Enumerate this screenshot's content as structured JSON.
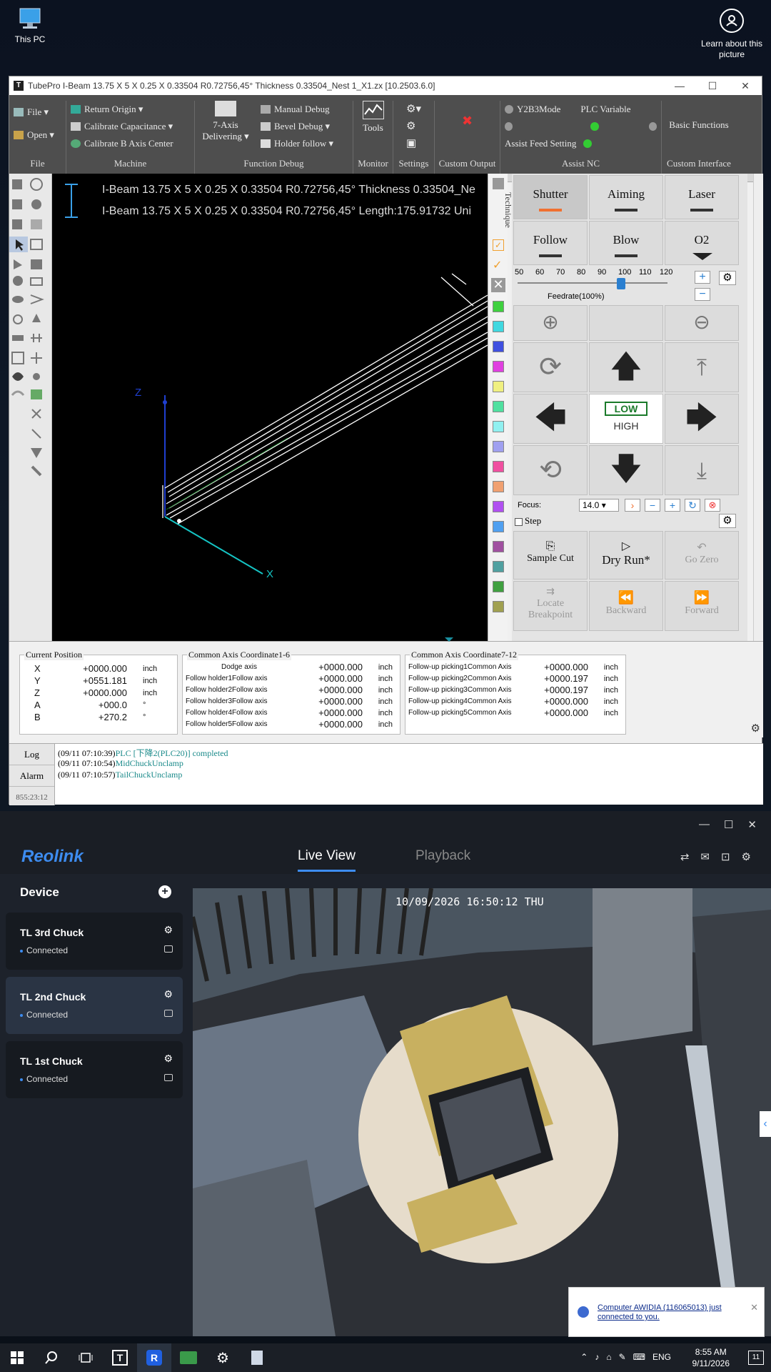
{
  "desktop": {
    "this_pc_label": "This PC",
    "learn_label": "Learn about this picture"
  },
  "tubepro": {
    "title": "TubePro I-Beam 13.75 X 5 X 0.25 X 0.33504  R0.72756,45° Thickness 0.33504_Nest 1_X1.zx  [10.2503.6.0]",
    "ribbon": {
      "file_label": "File",
      "open_label": "Open",
      "file_group": "File",
      "return_origin": "Return Origin",
      "calibrate_capacitance": "Calibrate Capacitance",
      "calibrate_b_axis": "Calibrate B Axis Center",
      "machine_group": "Machine",
      "seven_axis_line1": "7-Axis",
      "seven_axis_line2": "Delivering",
      "manual_debug": "Manual Debug",
      "bevel_debug": "Bevel Debug",
      "holder_follow": "Holder follow",
      "function_debug_group": "Function Debug",
      "tools_label": "Tools",
      "monitor_group": "Monitor",
      "settings_group": "Settings",
      "custom_output_group": "Custom Output",
      "y2b3mode": "Y2B3Mode",
      "plc_variable": "PLC Variable",
      "assist_feed_setting": "Assist Feed Setting",
      "assist_nc_group": "Assist NC",
      "basic_functions": "Basic Functions",
      "custom_interface_group": "Custom Interface"
    },
    "canvas": {
      "line1": "I-Beam 13.75 X 5 X 0.25 X 0.33504  R0.72756,45° Thickness 0.33504_Ne",
      "line2": "I-Beam 13.75 X 5 X 0.25 X 0.33504  R0.72756,45° Length:175.91732 Uni",
      "axis_z": "Z",
      "axis_x": "X",
      "technique_label": "Technique"
    },
    "panel": {
      "shutter": "Shutter",
      "aiming": "Aiming",
      "laser": "Laser",
      "follow": "Follow",
      "blow": "Blow",
      "o2": "O2",
      "feedrate_ticks": [
        "50",
        "60",
        "70",
        "80",
        "90",
        "100",
        "110",
        "120"
      ],
      "feedrate_label": "Feedrate(100%)",
      "feedrate_value": 100,
      "low": "LOW",
      "high": "HIGH",
      "focus_label": "Focus:",
      "focus_value": "14.0",
      "step_label": "Step",
      "sample_cut": "Sample Cut",
      "dry_run": "Dry Run*",
      "go_zero": "Go Zero",
      "locate_bp_line1": "Locate",
      "locate_bp_line2": "Breakpoint",
      "backward": "Backward",
      "forward": "Forward"
    },
    "current_position": {
      "caption": "Current Position",
      "rows": [
        {
          "axis": "X",
          "value": "+0000.000",
          "unit": "inch"
        },
        {
          "axis": "Y",
          "value": "+0551.181",
          "unit": "inch"
        },
        {
          "axis": "Z",
          "value": "+0000.000",
          "unit": "inch"
        },
        {
          "axis": "A",
          "value": "+000.0",
          "unit": "°"
        },
        {
          "axis": "B",
          "value": "+270.2",
          "unit": "°"
        }
      ]
    },
    "common_axis_1_6": {
      "caption": "Common Axis Coordinate1-6",
      "rows": [
        {
          "name": "Dodge axis",
          "value": "+0000.000",
          "unit": "inch"
        },
        {
          "name": "Follow holder1Follow axis",
          "value": "+0000.000",
          "unit": "inch"
        },
        {
          "name": "Follow holder2Follow axis",
          "value": "+0000.000",
          "unit": "inch"
        },
        {
          "name": "Follow holder3Follow axis",
          "value": "+0000.000",
          "unit": "inch"
        },
        {
          "name": "Follow holder4Follow axis",
          "value": "+0000.000",
          "unit": "inch"
        },
        {
          "name": "Follow holder5Follow axis",
          "value": "+0000.000",
          "unit": "inch"
        }
      ]
    },
    "common_axis_7_12": {
      "caption": "Common Axis Coordinate7-12",
      "rows": [
        {
          "name": "Follow-up picking1Common Axis",
          "value": "+0000.000",
          "unit": "inch"
        },
        {
          "name": "Follow-up picking2Common Axis",
          "value": "+0000.197",
          "unit": "inch"
        },
        {
          "name": "Follow-up picking3Common Axis",
          "value": "+0000.197",
          "unit": "inch"
        },
        {
          "name": "Follow-up picking4Common Axis",
          "value": "+0000.000",
          "unit": "inch"
        },
        {
          "name": "Follow-up picking5Common Axis",
          "value": "+0000.000",
          "unit": "inch"
        }
      ]
    },
    "log": {
      "tab_log": "Log",
      "tab_alarm": "Alarm",
      "side_time": "855:23:12",
      "lines": [
        {
          "time": "(09/11 07:10:39)",
          "msg": "PLC [下降2(PLC20)] completed"
        },
        {
          "time": "(09/11 07:10:54)",
          "msg": "MidChuckUnclamp"
        },
        {
          "time": "(09/11 07:10:57)",
          "msg": "TailChuckUnclamp"
        }
      ]
    }
  },
  "reolink": {
    "logo": "Reolink",
    "tab_live": "Live View",
    "tab_playback": "Playback",
    "device_header": "Device",
    "devices": [
      {
        "name": "TL 3rd Chuck",
        "status": "Connected"
      },
      {
        "name": "TL 2nd Chuck",
        "status": "Connected"
      },
      {
        "name": "TL 1st Chuck",
        "status": "Connected"
      }
    ],
    "video_timestamp": "10/09/2026 16:50:12 THU"
  },
  "toast": {
    "message": "Computer AWIDIA (116065013) just connected to you."
  },
  "taskbar": {
    "lang": "ENG",
    "time": "8:55 AM",
    "date": "9/11/2026",
    "notif_count": "11"
  }
}
